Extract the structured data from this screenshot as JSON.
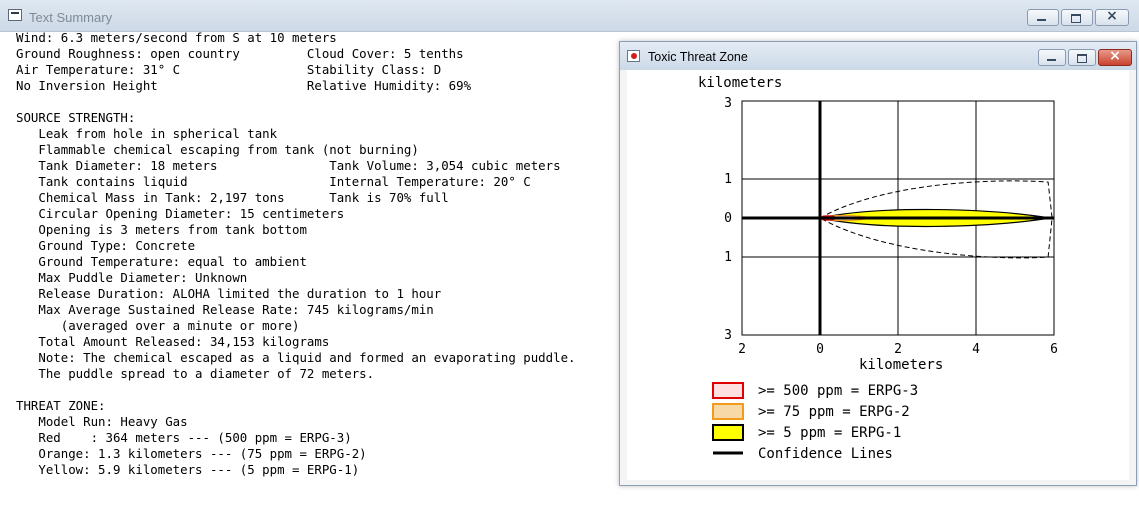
{
  "main_window": {
    "title": "Text Summary",
    "summary_lines": [
      "Wind: 6.3 meters/second from S at 10 meters",
      "Ground Roughness: open country         Cloud Cover: 5 tenths",
      "Air Temperature: 31° C                 Stability Class: D",
      "No Inversion Height                    Relative Humidity: 69%",
      "",
      "SOURCE STRENGTH:",
      "   Leak from hole in spherical tank",
      "   Flammable chemical escaping from tank (not burning)",
      "   Tank Diameter: 18 meters               Tank Volume: 3,054 cubic meters",
      "   Tank contains liquid                   Internal Temperature: 20° C",
      "   Chemical Mass in Tank: 2,197 tons      Tank is 70% full",
      "   Circular Opening Diameter: 15 centimeters",
      "   Opening is 3 meters from tank bottom",
      "   Ground Type: Concrete",
      "   Ground Temperature: equal to ambient",
      "   Max Puddle Diameter: Unknown",
      "   Release Duration: ALOHA limited the duration to 1 hour",
      "   Max Average Sustained Release Rate: 745 kilograms/min",
      "      (averaged over a minute or more)",
      "   Total Amount Released: 34,153 kilograms",
      "   Note: The chemical escaped as a liquid and formed an evaporating puddle.",
      "   The puddle spread to a diameter of 72 meters.",
      "",
      "THREAT ZONE:",
      "   Model Run: Heavy Gas",
      "   Red    : 364 meters --- (500 ppm = ERPG-3)",
      "   Orange: 1.3 kilometers --- (75 ppm = ERPG-2)",
      "   Yellow: 5.9 kilometers --- (5 ppm = ERPG-1)"
    ]
  },
  "threat_window": {
    "title": "Toxic Threat Zone",
    "legend": [
      {
        "label": ">= 500 ppm = ERPG-3",
        "fill": "#ffe0e0",
        "border": "#e00000"
      },
      {
        "label": ">= 75 ppm = ERPG-2",
        "fill": "#f7d9a8",
        "border": "#f39a1a"
      },
      {
        "label": ">= 5 ppm = ERPG-1",
        "fill": "#ffff00",
        "border": "#000000"
      },
      {
        "label": "Confidence Lines",
        "fill": "none",
        "border": "#000000"
      }
    ]
  },
  "chart_data": {
    "type": "area",
    "xlabel": "kilometers",
    "ylabel": "kilometers",
    "x_ticks": [
      "2",
      "0",
      "2",
      "4",
      "6"
    ],
    "y_ticks": [
      "3",
      "1",
      "0",
      "1",
      "3"
    ],
    "xlim": [
      -2,
      6
    ],
    "ylim": [
      -3,
      3
    ],
    "grid": true,
    "zones": [
      {
        "name": "Red",
        "threshold": ">= 500 ppm = ERPG-3",
        "downwind_km": 0.364,
        "color": "#e00000"
      },
      {
        "name": "Orange",
        "threshold": ">= 75 ppm = ERPG-2",
        "downwind_km": 1.3,
        "color": "#f39a1a"
      },
      {
        "name": "Yellow",
        "threshold": ">= 5 ppm = ERPG-1",
        "downwind_km": 5.9,
        "color": "#ffff00"
      }
    ],
    "confidence_lines": "dashed"
  }
}
